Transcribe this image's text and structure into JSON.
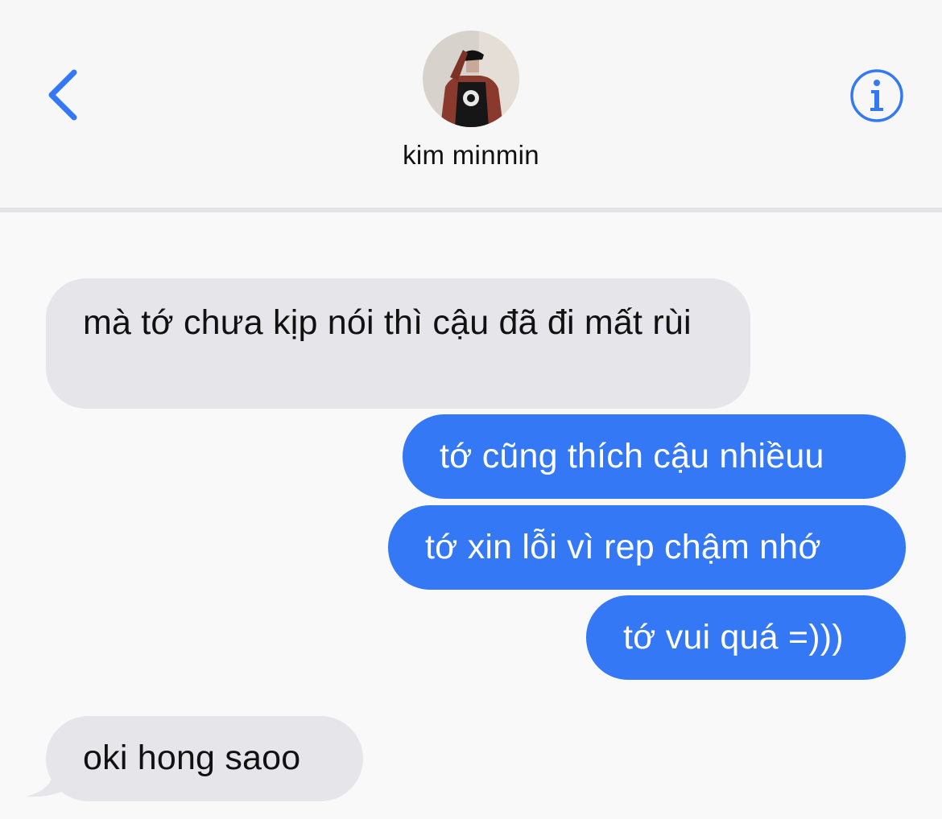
{
  "header": {
    "contact_name": "kim minmin",
    "back_icon": "chevron-left-icon",
    "info_icon": "info-circle-icon",
    "accent_color": "#3478f6"
  },
  "messages": [
    {
      "direction": "received",
      "text": "mà tớ chưa kịp nói thì cậu đã đi mất rùi"
    },
    {
      "direction": "sent",
      "text": "tớ cũng thích cậu nhiềuu"
    },
    {
      "direction": "sent",
      "text": "tớ xin lỗi vì rep chậm nhớ"
    },
    {
      "direction": "sent",
      "text": "tớ vui quá =)))"
    },
    {
      "direction": "received",
      "text": "oki hong saoo"
    }
  ],
  "colors": {
    "sent_bubble": "#3478f6",
    "received_bubble": "#e5e5ea",
    "background": "#f9f9f9"
  }
}
